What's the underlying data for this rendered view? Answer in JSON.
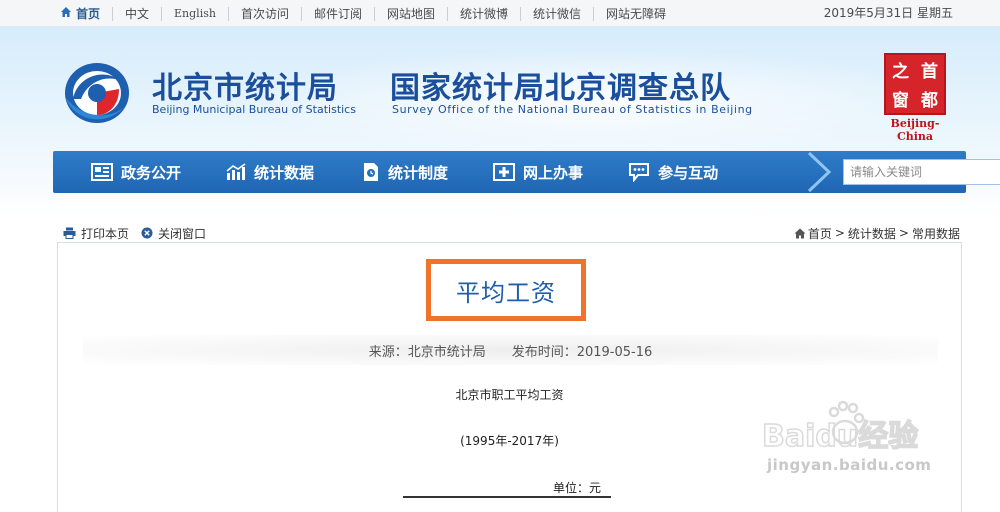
{
  "topbar": {
    "nav": [
      {
        "label": "首页"
      },
      {
        "label": "中文"
      },
      {
        "label": "English"
      },
      {
        "label": "首次访问"
      },
      {
        "label": "邮件订阅"
      },
      {
        "label": "网站地图"
      },
      {
        "label": "统计微博"
      },
      {
        "label": "统计微信"
      },
      {
        "label": "网站无障碍"
      }
    ],
    "date": "2019年5月31日 星期五"
  },
  "header": {
    "bureau_cn": "北京市统计局",
    "bureau_en": "Beijing Municipal Bureau of Statistics",
    "survey_cn": "国家统计局北京调查总队",
    "survey_en": "Survey Office of the National Bureau of Statistics in Beijing",
    "seal_chars": [
      "之",
      "首",
      "窗",
      "都"
    ],
    "seal_label": "Beijing-China"
  },
  "mainnav": {
    "items": [
      {
        "label": "政务公开",
        "icon": "newspaper-icon"
      },
      {
        "label": "统计数据",
        "icon": "bar-chart-icon"
      },
      {
        "label": "统计制度",
        "icon": "document-icon"
      },
      {
        "label": "网上办事",
        "icon": "plus-grid-icon"
      },
      {
        "label": "参与互动",
        "icon": "chat-icon"
      }
    ],
    "search_placeholder": "请输入关键词"
  },
  "tools": {
    "print_label": "打印本页",
    "close_label": "关闭窗口"
  },
  "breadcrumb": [
    "首页",
    "统计数据",
    "常用数据"
  ],
  "article": {
    "title": "平均工资",
    "source_label": "来源：北京市统计局",
    "date_label": "发布时间：2019-05-16",
    "heading": "北京市职工平均工资",
    "years": "(1995年-2017年)",
    "unit": "单位：元"
  },
  "watermark": {
    "brand": "Baidu经验",
    "url": "jingyan.baidu.com"
  },
  "colors": {
    "brand_blue": "#1b4f9c",
    "nav_blue": "#2171bd",
    "highlight_orange": "#f0732c",
    "seal_red": "#d6242b"
  }
}
